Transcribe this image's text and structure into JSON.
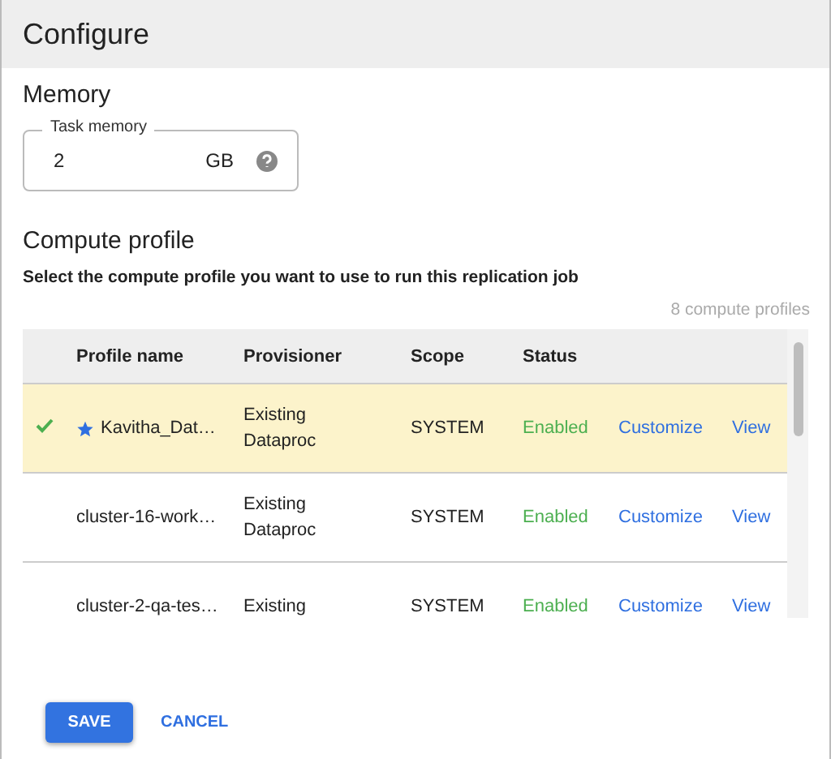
{
  "dialog": {
    "title": "Configure"
  },
  "memory": {
    "heading": "Memory",
    "field": {
      "label": "Task memory",
      "value": "2",
      "unit": "GB"
    }
  },
  "compute": {
    "heading": "Compute profile",
    "description": "Select the compute profile you want to use to run this replication job",
    "count": "8 compute profiles",
    "columns": [
      "Profile name",
      "Provisioner",
      "Scope",
      "Status"
    ],
    "rows": [
      {
        "selected": true,
        "starred": true,
        "name": "Kavitha_Dat…",
        "provisioner": [
          "Existing",
          "Dataproc"
        ],
        "scope": "SYSTEM",
        "status": "Enabled",
        "actions": [
          "Customize",
          "View"
        ]
      },
      {
        "selected": false,
        "starred": false,
        "name": "cluster-16-work…",
        "provisioner": [
          "Existing",
          "Dataproc"
        ],
        "scope": "SYSTEM",
        "status": "Enabled",
        "actions": [
          "Customize",
          "View"
        ]
      },
      {
        "selected": false,
        "starred": false,
        "name": "cluster-2-qa-tes…",
        "provisioner": [
          "Existing"
        ],
        "scope": "SYSTEM",
        "status": "Enabled",
        "actions": [
          "Customize",
          "View"
        ]
      }
    ]
  },
  "buttons": [
    {
      "label": "SAVE",
      "kind": "primary"
    },
    {
      "label": "CANCEL",
      "kind": "text"
    }
  ]
}
